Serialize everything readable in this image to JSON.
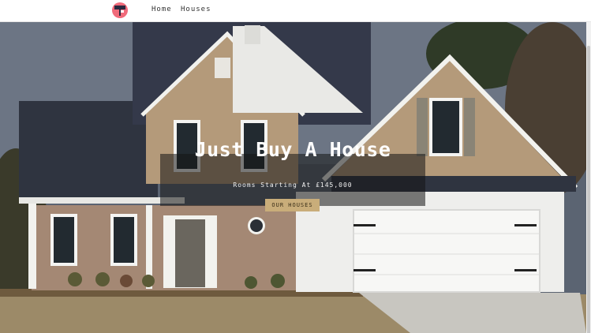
{
  "navbar": {
    "logo_icon": "house-mailbox-icon",
    "links": [
      {
        "label": "Home"
      },
      {
        "label": "Houses"
      }
    ]
  },
  "hero": {
    "title": "Just Buy A House",
    "subtitle": "Rooms Starting At £145,000",
    "button_label": "OUR HOUSES"
  },
  "colors": {
    "overlay": "#141414",
    "button_bg": "#c9ad7a",
    "logo_bg": "#f06a7a"
  }
}
